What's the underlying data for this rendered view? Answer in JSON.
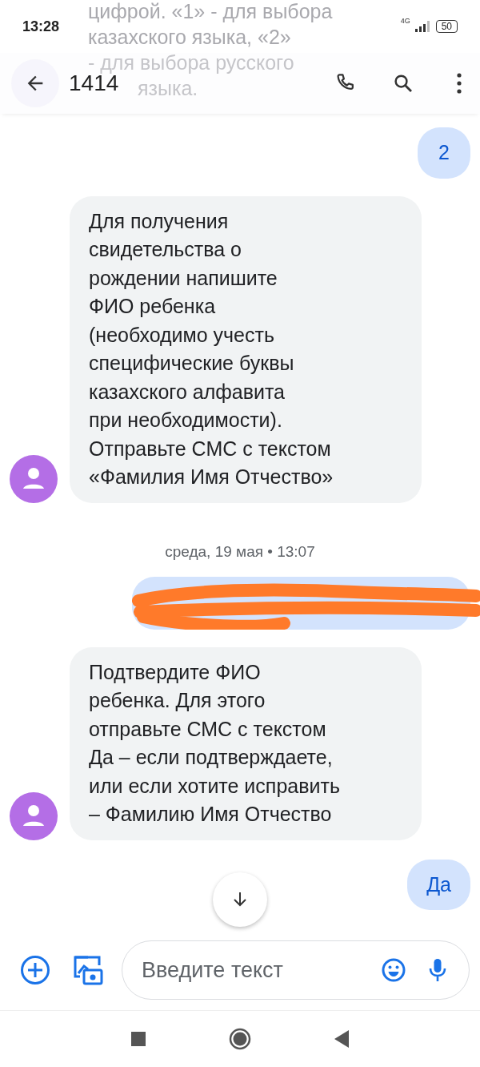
{
  "status_bar": {
    "time": "13:28",
    "network": "4G",
    "battery": "50"
  },
  "ghost_lines": [
    "цифрой. «1» - для выбора",
    "казахского языка, «2»",
    "- для выбора русского",
    "языка."
  ],
  "header": {
    "title": "1414"
  },
  "messages": [
    {
      "kind": "sent",
      "text": "2",
      "redacted": false
    },
    {
      "kind": "received",
      "text": "Для получения\nсвидетельства о\nрождении напишите\nФИО ребенка\n(необходимо учесть\nспецифические буквы\nказахского алфавита\nпри необходимости).\nОтправьте СМС с текстом\n«Фамилия Имя Отчество»",
      "redacted": false
    },
    {
      "kind": "timestamp",
      "text": "среда, 19 мая • 13:07",
      "redacted": false
    },
    {
      "kind": "sent",
      "redacted": true
    },
    {
      "kind": "received",
      "text": "Подтвердите ФИО\nребенка. Для этого\nотправьте СМС с текстом\nДа – если подтверждаете,\nили если хотите исправить\n– Фамилию Имя Отчество",
      "redacted": false
    },
    {
      "kind": "sent",
      "text": "Да",
      "redacted": false
    }
  ],
  "composer": {
    "placeholder": "Введите текст"
  }
}
